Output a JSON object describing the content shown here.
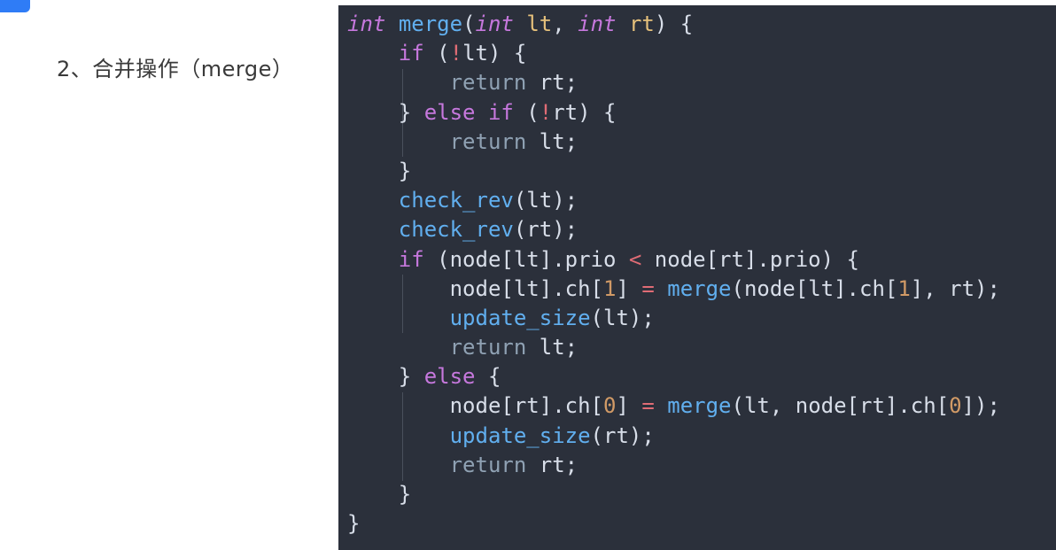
{
  "heading": "2、合并操作（merge）",
  "watermark": "",
  "code": {
    "lines": [
      [
        {
          "t": "int",
          "c": "type"
        },
        {
          "t": " "
        },
        {
          "t": "merge",
          "c": "fn"
        },
        {
          "t": "("
        },
        {
          "t": "int",
          "c": "type"
        },
        {
          "t": " "
        },
        {
          "t": "lt",
          "c": "param"
        },
        {
          "t": ", "
        },
        {
          "t": "int",
          "c": "type"
        },
        {
          "t": " "
        },
        {
          "t": "rt",
          "c": "param"
        },
        {
          "t": ") {"
        }
      ],
      [
        {
          "t": "    "
        },
        {
          "t": "if",
          "c": "kw"
        },
        {
          "t": " ("
        },
        {
          "t": "!",
          "c": "op"
        },
        {
          "t": "lt) {"
        }
      ],
      [
        {
          "t": "        "
        },
        {
          "t": "return",
          "c": "ret"
        },
        {
          "t": " rt;"
        }
      ],
      [
        {
          "t": "    } "
        },
        {
          "t": "else",
          "c": "kw"
        },
        {
          "t": " "
        },
        {
          "t": "if",
          "c": "kw"
        },
        {
          "t": " ("
        },
        {
          "t": "!",
          "c": "op"
        },
        {
          "t": "rt) {"
        }
      ],
      [
        {
          "t": "        "
        },
        {
          "t": "return",
          "c": "ret"
        },
        {
          "t": " lt;"
        }
      ],
      [
        {
          "t": "    }"
        }
      ],
      [
        {
          "t": "    "
        },
        {
          "t": "check_rev",
          "c": "fn"
        },
        {
          "t": "(lt);"
        }
      ],
      [
        {
          "t": "    "
        },
        {
          "t": "check_rev",
          "c": "fn"
        },
        {
          "t": "(rt);"
        }
      ],
      [
        {
          "t": "    "
        },
        {
          "t": "if",
          "c": "kw"
        },
        {
          "t": " (node[lt].prio "
        },
        {
          "t": "<",
          "c": "op"
        },
        {
          "t": " node[rt].prio) {"
        }
      ],
      [
        {
          "t": "        node[lt].ch["
        },
        {
          "t": "1",
          "c": "num"
        },
        {
          "t": "] "
        },
        {
          "t": "=",
          "c": "op"
        },
        {
          "t": " "
        },
        {
          "t": "merge",
          "c": "fn"
        },
        {
          "t": "(node[lt].ch["
        },
        {
          "t": "1",
          "c": "num"
        },
        {
          "t": "], rt);"
        }
      ],
      [
        {
          "t": "        "
        },
        {
          "t": "update_size",
          "c": "fn"
        },
        {
          "t": "(lt);"
        }
      ],
      [
        {
          "t": "        "
        },
        {
          "t": "return",
          "c": "ret"
        },
        {
          "t": " lt;"
        }
      ],
      [
        {
          "t": "    } "
        },
        {
          "t": "else",
          "c": "kw"
        },
        {
          "t": " {"
        }
      ],
      [
        {
          "t": "        node[rt].ch["
        },
        {
          "t": "0",
          "c": "num"
        },
        {
          "t": "] "
        },
        {
          "t": "=",
          "c": "op"
        },
        {
          "t": " "
        },
        {
          "t": "merge",
          "c": "fn"
        },
        {
          "t": "(lt, node[rt].ch["
        },
        {
          "t": "0",
          "c": "num"
        },
        {
          "t": "]);"
        }
      ],
      [
        {
          "t": "        "
        },
        {
          "t": "update_size",
          "c": "fn"
        },
        {
          "t": "(rt);"
        }
      ],
      [
        {
          "t": "        "
        },
        {
          "t": "return",
          "c": "ret"
        },
        {
          "t": " rt;"
        }
      ],
      [
        {
          "t": "    }"
        }
      ],
      [
        {
          "t": "}"
        }
      ]
    ]
  },
  "colors": {
    "panel_bg": "#2b303b",
    "accent": "#2f7cf6"
  }
}
